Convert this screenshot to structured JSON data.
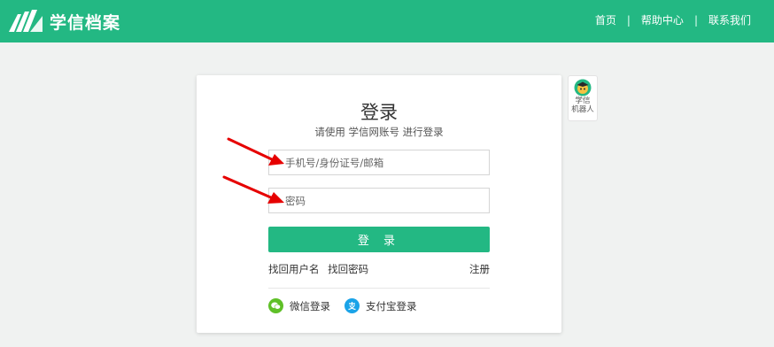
{
  "header": {
    "logo_text": "学信档案",
    "nav": [
      {
        "label": "首页"
      },
      {
        "label": "帮助中心"
      },
      {
        "label": "联系我们"
      }
    ],
    "separator": "|"
  },
  "login": {
    "title": "登录",
    "subtitle": "请使用 学信网账号 进行登录",
    "username_placeholder": "手机号/身份证号/邮箱",
    "password_placeholder": "密码",
    "submit_label": "登 录",
    "find_username": "找回用户名",
    "find_password": "找回密码",
    "register": "注册",
    "social": [
      {
        "label": "微信登录",
        "icon": "wechat-icon"
      },
      {
        "label": "支付宝登录",
        "icon": "alipay-icon"
      }
    ]
  },
  "robot": {
    "label_line1": "学信",
    "label_line2": "机器人"
  },
  "colors": {
    "brand": "#23b883",
    "background": "#f0f2f1",
    "annotation_arrow": "#e60000"
  }
}
